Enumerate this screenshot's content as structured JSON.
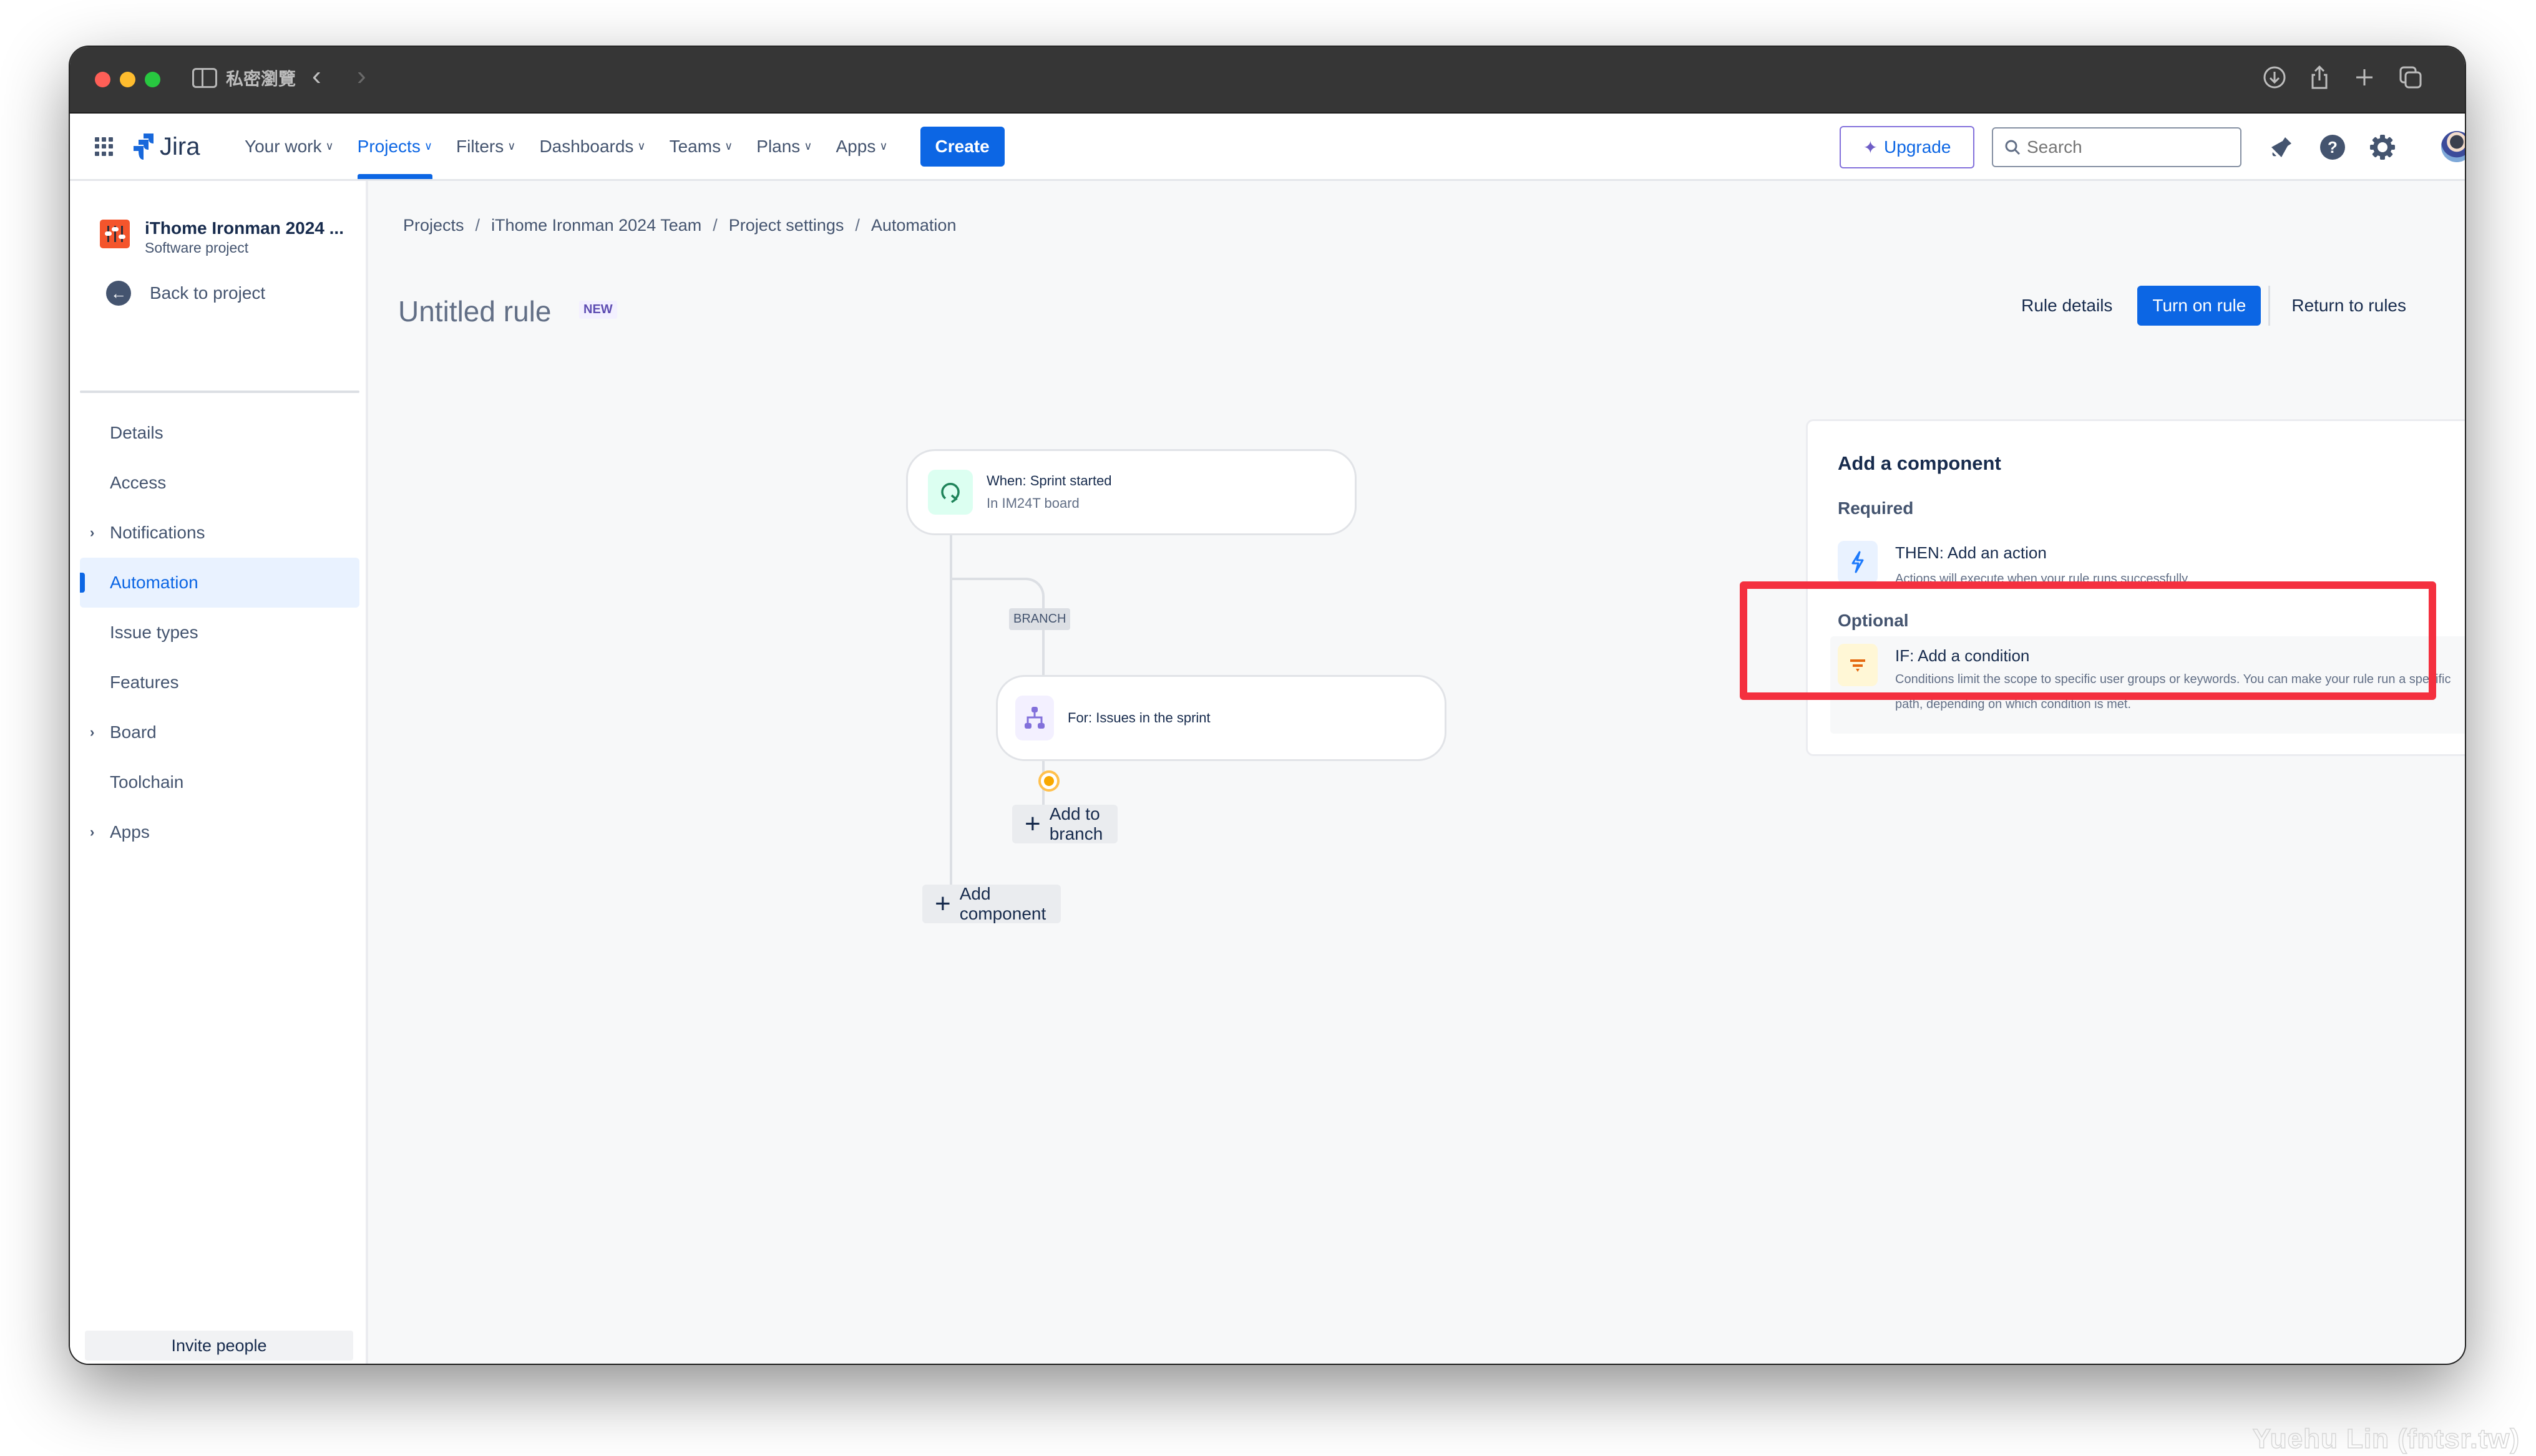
{
  "browser": {
    "window_title": "私密瀏覽",
    "icons": [
      "sidebar-toggle-icon",
      "back-icon",
      "forward-icon",
      "download-icon",
      "share-icon",
      "new-tab-icon",
      "tab-overview-icon"
    ]
  },
  "topnav": {
    "product": "Jira",
    "items": [
      {
        "label": "Your work",
        "active": false
      },
      {
        "label": "Projects",
        "active": true
      },
      {
        "label": "Filters",
        "active": false
      },
      {
        "label": "Dashboards",
        "active": false
      },
      {
        "label": "Teams",
        "active": false
      },
      {
        "label": "Plans",
        "active": false
      },
      {
        "label": "Apps",
        "active": false
      }
    ],
    "create_label": "Create",
    "upgrade_label": "Upgrade",
    "search_placeholder": "Search",
    "icons": [
      "notifications-icon",
      "help-icon",
      "settings-icon",
      "avatar"
    ]
  },
  "sidebar": {
    "project_name": "iThome Ironman 2024 ...",
    "project_type": "Software project",
    "back_label": "Back to project",
    "items": [
      {
        "label": "Details",
        "expandable": false,
        "active": false
      },
      {
        "label": "Access",
        "expandable": false,
        "active": false
      },
      {
        "label": "Notifications",
        "expandable": true,
        "active": false
      },
      {
        "label": "Automation",
        "expandable": false,
        "active": true
      },
      {
        "label": "Issue types",
        "expandable": false,
        "active": false
      },
      {
        "label": "Features",
        "expandable": false,
        "active": false
      },
      {
        "label": "Board",
        "expandable": true,
        "active": false
      },
      {
        "label": "Toolchain",
        "expandable": false,
        "active": false
      },
      {
        "label": "Apps",
        "expandable": true,
        "active": false
      }
    ],
    "invite_label": "Invite people"
  },
  "main": {
    "breadcrumb": [
      "Projects",
      "iThome Ironman 2024 Team",
      "Project settings",
      "Automation"
    ],
    "breadcrumb_separator": "/",
    "rule_title": "Untitled rule",
    "rule_badge": "NEW",
    "actions": {
      "rule_details": "Rule details",
      "turn_on": "Turn on rule",
      "return": "Return to rules"
    },
    "flow": {
      "trigger": {
        "title": "When: Sprint started",
        "subtitle": "In IM24T board"
      },
      "branch_label": "BRANCH",
      "branch": {
        "title": "For: Issues in the sprint"
      },
      "add_to_branch": "Add to branch",
      "add_component": "Add component"
    },
    "panel": {
      "title": "Add a component",
      "required_label": "Required",
      "optional_label": "Optional",
      "action": {
        "title": "THEN: Add an action",
        "description": "Actions will execute when your rule runs successfully."
      },
      "condition": {
        "title": "IF: Add a condition",
        "description": "Conditions limit the scope to specific user groups or keywords. You can make your rule run a specific path, depending on which condition is met."
      }
    }
  },
  "colors": {
    "brand_blue": "#0C66E4",
    "highlight_red": "#F4303F",
    "trigger_green": "#1F845A",
    "branch_purple": "#8270DB",
    "condition_orange": "#E56910",
    "dot_yellow": "#F8A800"
  },
  "watermark": "Yuehu Lin (fntsr.tw)"
}
